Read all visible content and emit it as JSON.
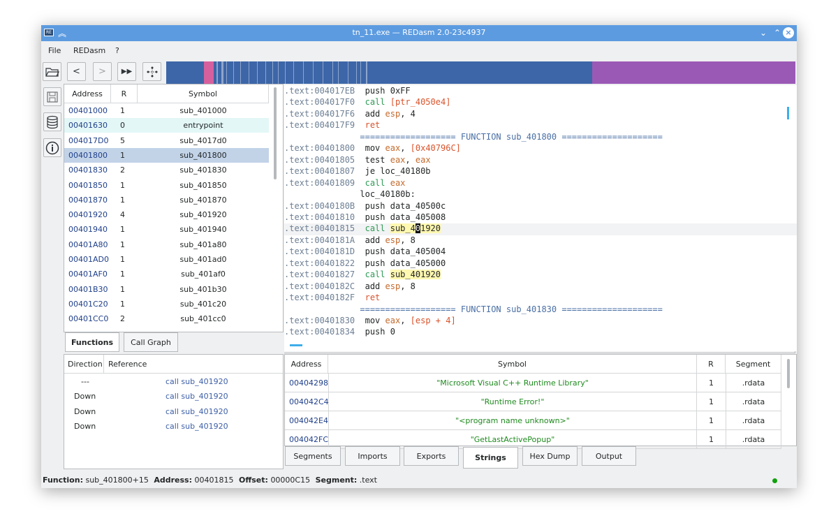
{
  "window": {
    "title": "tn_11.exe — REDasm 2.0-23c4937"
  },
  "menu": [
    "File",
    "REDasm",
    "?"
  ],
  "colors": {
    "titlebar": "#5c9be0",
    "nav_code": "#3d66a8",
    "nav_data": "#9b59b6",
    "nav_marker": "#d6609e",
    "selected_row": "#c2d3e8",
    "entry_row": "#e3f7f7"
  },
  "functions": {
    "headers": {
      "address": "Address",
      "r": "R",
      "symbol": "Symbol"
    },
    "rows": [
      {
        "address": "00401000",
        "r": "1",
        "symbol": "sub_401000"
      },
      {
        "address": "00401630",
        "r": "0",
        "symbol": "entrypoint"
      },
      {
        "address": "004017D0",
        "r": "5",
        "symbol": "sub_4017d0"
      },
      {
        "address": "00401800",
        "r": "1",
        "symbol": "sub_401800"
      },
      {
        "address": "00401830",
        "r": "2",
        "symbol": "sub_401830"
      },
      {
        "address": "00401850",
        "r": "1",
        "symbol": "sub_401850"
      },
      {
        "address": "00401870",
        "r": "1",
        "symbol": "sub_401870"
      },
      {
        "address": "00401920",
        "r": "4",
        "symbol": "sub_401920"
      },
      {
        "address": "00401940",
        "r": "1",
        "symbol": "sub_401940"
      },
      {
        "address": "00401A80",
        "r": "1",
        "symbol": "sub_401a80"
      },
      {
        "address": "00401AD0",
        "r": "1",
        "symbol": "sub_401ad0"
      },
      {
        "address": "00401AF0",
        "r": "1",
        "symbol": "sub_401af0"
      },
      {
        "address": "00401B30",
        "r": "1",
        "symbol": "sub_401b30"
      },
      {
        "address": "00401C20",
        "r": "1",
        "symbol": "sub_401c20"
      },
      {
        "address": "00401CC0",
        "r": "2",
        "symbol": "sub_401cc0"
      }
    ],
    "tabs": [
      "Functions",
      "Call Graph"
    ]
  },
  "references": {
    "headers": {
      "direction": "Direction",
      "reference": "Reference"
    },
    "rows": [
      {
        "direction": "---",
        "reference": "call sub_401920"
      },
      {
        "direction": "Down",
        "reference": "call sub_401920"
      },
      {
        "direction": "Down",
        "reference": "call sub_401920"
      },
      {
        "direction": "Down",
        "reference": "call sub_401920"
      }
    ]
  },
  "code": [
    {
      "addr": ".text:004017EB",
      "parts": [
        [
          "m",
          "push 0xFF"
        ]
      ]
    },
    {
      "addr": ".text:004017F0",
      "parts": [
        [
          "k",
          "call "
        ],
        [
          "r",
          "[ptr_4050e4]"
        ]
      ]
    },
    {
      "addr": ".text:004017F6",
      "parts": [
        [
          "m",
          "add "
        ],
        [
          "reg",
          "esp"
        ],
        [
          "m",
          ", 4"
        ]
      ]
    },
    {
      "addr": ".text:004017F9",
      "parts": [
        [
          "r",
          "ret"
        ]
      ]
    },
    {
      "addr": "",
      "parts": [
        [
          "fn",
          "               =================== FUNCTION sub_401800 ===================="
        ]
      ]
    },
    {
      "addr": ".text:00401800",
      "parts": [
        [
          "m",
          "mov "
        ],
        [
          "reg",
          "eax"
        ],
        [
          "m",
          ", "
        ],
        [
          "r",
          "[0x40796C]"
        ]
      ]
    },
    {
      "addr": ".text:00401805",
      "parts": [
        [
          "m",
          "test "
        ],
        [
          "reg",
          "eax"
        ],
        [
          "m",
          ", "
        ],
        [
          "reg",
          "eax"
        ]
      ]
    },
    {
      "addr": ".text:00401807",
      "parts": [
        [
          "m",
          "je loc_40180b"
        ]
      ]
    },
    {
      "addr": ".text:00401809",
      "parts": [
        [
          "k",
          "call "
        ],
        [
          "reg",
          "eax"
        ]
      ]
    },
    {
      "addr": "",
      "parts": [
        [
          "lb",
          "               loc_40180b:"
        ]
      ]
    },
    {
      "addr": ".text:0040180B",
      "parts": [
        [
          "m",
          "push data_40500c"
        ]
      ]
    },
    {
      "addr": ".text:00401810",
      "parts": [
        [
          "m",
          "push data_405008"
        ]
      ]
    },
    {
      "addr": ".text:00401815",
      "parts": [
        [
          "k",
          "call "
        ],
        [
          "hl",
          "sub_4"
        ],
        [
          "cur",
          "0"
        ],
        [
          "hl",
          "1920"
        ]
      ]
    },
    {
      "addr": ".text:0040181A",
      "parts": [
        [
          "m",
          "add "
        ],
        [
          "reg",
          "esp"
        ],
        [
          "m",
          ", 8"
        ]
      ]
    },
    {
      "addr": ".text:0040181D",
      "parts": [
        [
          "m",
          "push data_405004"
        ]
      ]
    },
    {
      "addr": ".text:00401822",
      "parts": [
        [
          "m",
          "push data_405000"
        ]
      ]
    },
    {
      "addr": ".text:00401827",
      "parts": [
        [
          "k",
          "call "
        ],
        [
          "hl",
          "sub_401920"
        ]
      ]
    },
    {
      "addr": ".text:0040182C",
      "parts": [
        [
          "m",
          "add "
        ],
        [
          "reg",
          "esp"
        ],
        [
          "m",
          ", 8"
        ]
      ]
    },
    {
      "addr": ".text:0040182F",
      "parts": [
        [
          "r",
          "ret"
        ]
      ]
    },
    {
      "addr": "",
      "parts": [
        [
          "fn",
          "               =================== FUNCTION sub_401830 ===================="
        ]
      ]
    },
    {
      "addr": ".text:00401830",
      "parts": [
        [
          "m",
          "mov "
        ],
        [
          "reg",
          "eax"
        ],
        [
          "m",
          ", "
        ],
        [
          "r",
          "[esp + 4]"
        ]
      ]
    },
    {
      "addr": ".text:00401834",
      "parts": [
        [
          "m",
          "push 0"
        ]
      ]
    }
  ],
  "strings": {
    "headers": {
      "address": "Address",
      "symbol": "Symbol",
      "r": "R",
      "segment": "Segment"
    },
    "rows": [
      {
        "address": "00404298",
        "symbol": "\"Microsoft Visual C++ Runtime Library\"",
        "r": "1",
        "segment": ".rdata"
      },
      {
        "address": "004042C4",
        "symbol": "\"Runtime Error!\"",
        "r": "1",
        "segment": ".rdata"
      },
      {
        "address": "004042E4",
        "symbol": "\"<program name unknown>\"",
        "r": "1",
        "segment": ".rdata"
      },
      {
        "address": "004042FC",
        "symbol": "\"GetLastActivePopup\"",
        "r": "1",
        "segment": ".rdata"
      }
    ],
    "tabs": [
      "Segments",
      "Imports",
      "Exports",
      "Strings",
      "Hex Dump",
      "Output"
    ]
  },
  "status": {
    "function_label": "Function:",
    "function_value": "sub_401800+15",
    "address_label": "Address:",
    "address_value": "00401815",
    "offset_label": "Offset:",
    "offset_value": "00000C15",
    "segment_label": "Segment:",
    "segment_value": ".text"
  }
}
